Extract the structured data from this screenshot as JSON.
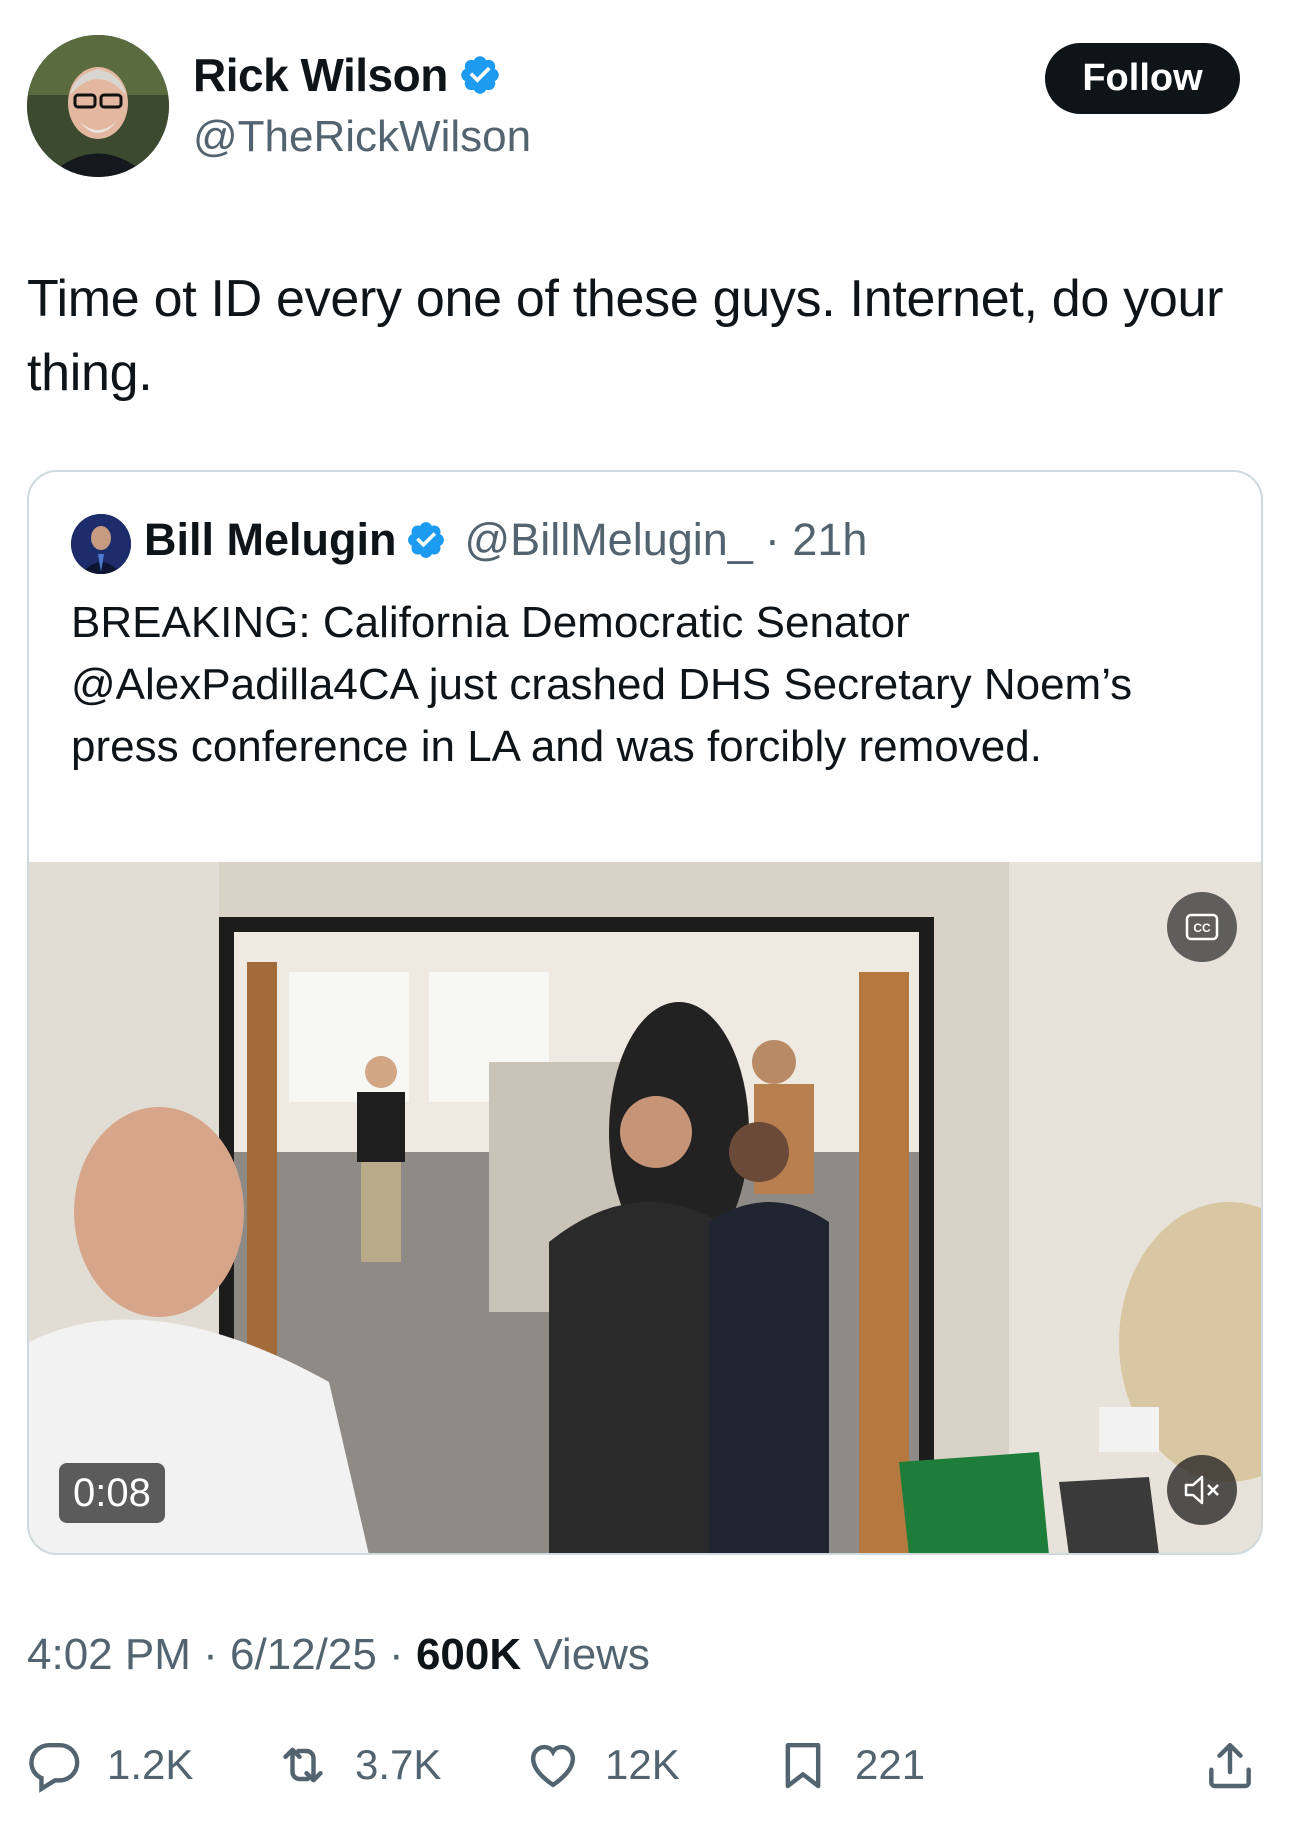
{
  "author": {
    "name": "Rick Wilson",
    "handle": "@TheRickWilson",
    "verified": true,
    "avatar_icon": "profile-photo"
  },
  "follow_label": "Follow",
  "tweet_text": "Time ot ID every one of these guys. Internet, do your thing.",
  "quoted": {
    "name": "Bill Melugin",
    "handle": "@BillMelugin_",
    "time": "· 21h",
    "verified": true,
    "text": "BREAKING: California Democratic Senator @AlexPadilla4CA just crashed DHS Secretary Noem’s press conference in LA and was forcibly removed.",
    "video": {
      "duration": "0:08",
      "cc_icon": "closed-captions-icon",
      "mute_icon": "muted-speaker-icon"
    }
  },
  "meta": {
    "time": "4:02 PM",
    "date": "6/12/25",
    "views_count": "600K",
    "views_label": "Views"
  },
  "actions": {
    "replies": "1.2K",
    "reposts": "3.7K",
    "likes": "12K",
    "bookmarks": "221"
  },
  "colors": {
    "verified_blue": "#1d9bf0",
    "text": "#0f1419",
    "secondary": "#536471",
    "border": "#cfd9de"
  }
}
